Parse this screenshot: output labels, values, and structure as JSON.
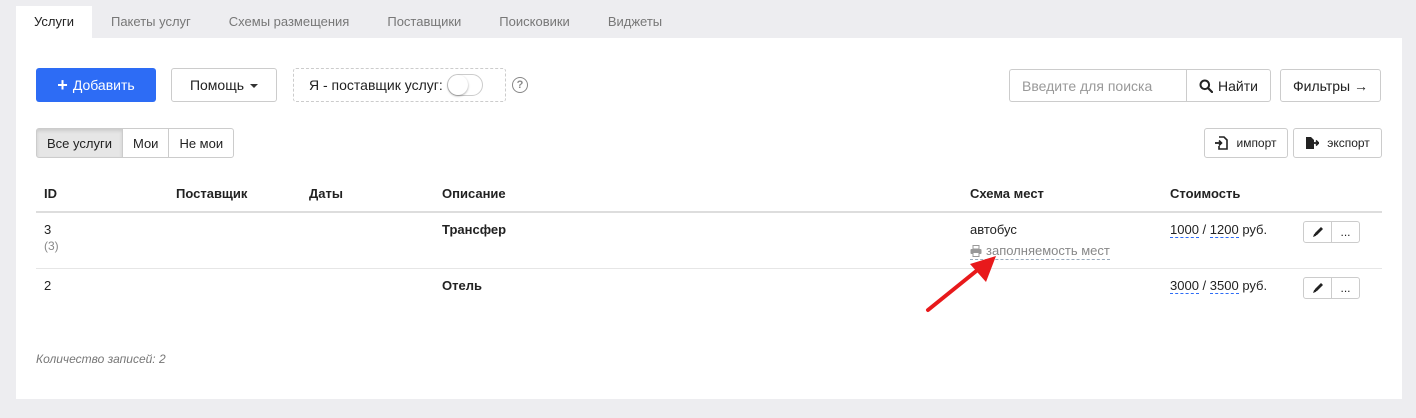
{
  "tabs": [
    {
      "label": "Услуги",
      "active": true
    },
    {
      "label": "Пакеты услуг",
      "active": false
    },
    {
      "label": "Схемы размещения",
      "active": false
    },
    {
      "label": "Поставщики",
      "active": false
    },
    {
      "label": "Поисковики",
      "active": false
    },
    {
      "label": "Виджеты",
      "active": false
    }
  ],
  "toolbar": {
    "add_label": "Добавить",
    "help_label": "Помощь",
    "supplier_label": "Я - поставщик услуг:",
    "supplier_toggle_on": false,
    "help_icon_text": "?",
    "search_placeholder": "Введите для поиска",
    "search_value": "",
    "search_label": "Найти",
    "filters_label": "Фильтры →"
  },
  "filter_segments": {
    "items": [
      "Все услуги",
      "Мои",
      "Не мои"
    ],
    "selected": "Все услуги"
  },
  "io": {
    "import_label": "импорт",
    "export_label": "экспорт"
  },
  "table": {
    "headers": {
      "id": "ID",
      "supplier": "Поставщик",
      "dates": "Даты",
      "description": "Описание",
      "seating": "Схема мест",
      "price": "Стоимость"
    },
    "rows": [
      {
        "id": "3",
        "sub_id": "(3)",
        "supplier": "",
        "dates": "",
        "description": "Трансфер",
        "seating": "автобус",
        "occupancy_link": "заполняемость мест",
        "price1": "1000",
        "price2": "1200",
        "currency": "руб.",
        "more_label": "..."
      },
      {
        "id": "2",
        "sub_id": "",
        "supplier": "",
        "dates": "",
        "description": "Отель",
        "seating": "",
        "occupancy_link": "",
        "price1": "3000",
        "price2": "3500",
        "currency": "руб.",
        "more_label": "..."
      }
    ]
  },
  "footer": {
    "count_text": "Количество записей: 2"
  },
  "colors": {
    "primary": "#2d6cf5",
    "annotation_arrow": "#e8191b",
    "background": "#ededf0"
  }
}
